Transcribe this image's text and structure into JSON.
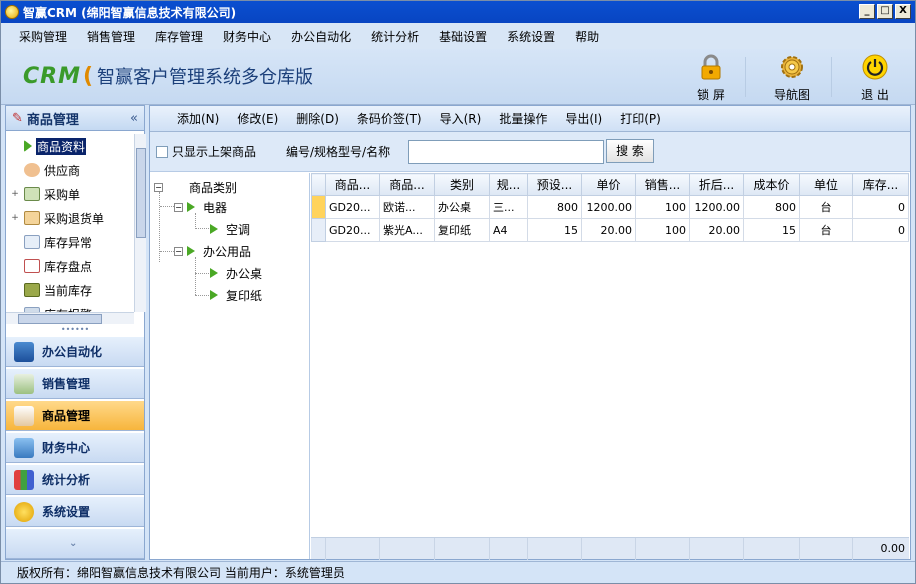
{
  "window": {
    "title": "智赢CRM (绵阳智赢信息技术有限公司)",
    "min": "_",
    "max": "□",
    "close": "X"
  },
  "menu": [
    "采购管理",
    "销售管理",
    "库存管理",
    "财务中心",
    "办公自动化",
    "统计分析",
    "基础设置",
    "系统设置",
    "帮助"
  ],
  "banner": {
    "logo_text": "CRM",
    "app_name": "智赢客户管理系统多仓库版",
    "buttons": [
      {
        "label": "锁 屏",
        "icon": "lock-icon"
      },
      {
        "label": "导航图",
        "icon": "gear-icon"
      },
      {
        "label": "退 出",
        "icon": "power-icon"
      }
    ]
  },
  "sidebar": {
    "title": "商品管理",
    "collapse": "«",
    "items": [
      {
        "label": "商品资料",
        "selected": true,
        "icon": "green-arrow-icon"
      },
      {
        "label": "供应商",
        "icon": "person-icon"
      },
      {
        "label": "采购单",
        "icon": "pencil-doc-icon",
        "expander": "+"
      },
      {
        "label": "采购退货单",
        "icon": "return-doc-icon",
        "expander": "+"
      },
      {
        "label": "库存异常",
        "icon": "alert-doc-icon"
      },
      {
        "label": "库存盘点",
        "icon": "calendar-icon"
      },
      {
        "label": "当前库存",
        "icon": "box-icon"
      },
      {
        "label": "库存报警",
        "icon": "alarm-icon"
      }
    ],
    "grip": "••••••",
    "nav": [
      {
        "label": "办公自动化",
        "icon": "monitor-icon",
        "active": false
      },
      {
        "label": "销售管理",
        "icon": "check-icon",
        "active": false
      },
      {
        "label": "商品管理",
        "icon": "product-icon",
        "active": true
      },
      {
        "label": "财务中心",
        "icon": "finance-icon",
        "active": false
      },
      {
        "label": "统计分析",
        "icon": "chart-icon",
        "active": false
      },
      {
        "label": "系统设置",
        "icon": "settings-icon",
        "active": false
      }
    ]
  },
  "toolbar": [
    "添加(N)",
    "修改(E)",
    "删除(D)",
    "条码价签(T)",
    "导入(R)",
    "批量操作",
    "导出(I)",
    "打印(P)"
  ],
  "search": {
    "checkbox_label": "只显示上架商品",
    "field_label": "编号/规格型号/名称",
    "value": "",
    "button": "搜 索"
  },
  "category_tree": {
    "root": "商品类别",
    "nodes": [
      "电器",
      "空调",
      "办公用品",
      "办公桌",
      "复印纸"
    ]
  },
  "grid": {
    "columns": [
      "商品...",
      "商品...",
      "类别",
      "规...",
      "预设...",
      "单价",
      "销售...",
      "折后...",
      "成本价",
      "单位",
      "库存..."
    ],
    "rows": [
      [
        "GD20...",
        "欧诺...",
        "办公桌",
        "三...",
        "800",
        "1200.00",
        "100",
        "1200.00",
        "800",
        "台",
        "0"
      ],
      [
        "GD20...",
        "紫光A...",
        "复印纸",
        "A4",
        "15",
        "20.00",
        "100",
        "20.00",
        "15",
        "台",
        "0"
      ]
    ],
    "footer_total": "0.00"
  },
  "status": {
    "text": "版权所有：绵阳智赢信息技术有限公司  当前用户：系统管理员"
  },
  "colors": {
    "title": "#0845c2",
    "accent_active": "#f7b53c",
    "selection": "#0a246a"
  }
}
